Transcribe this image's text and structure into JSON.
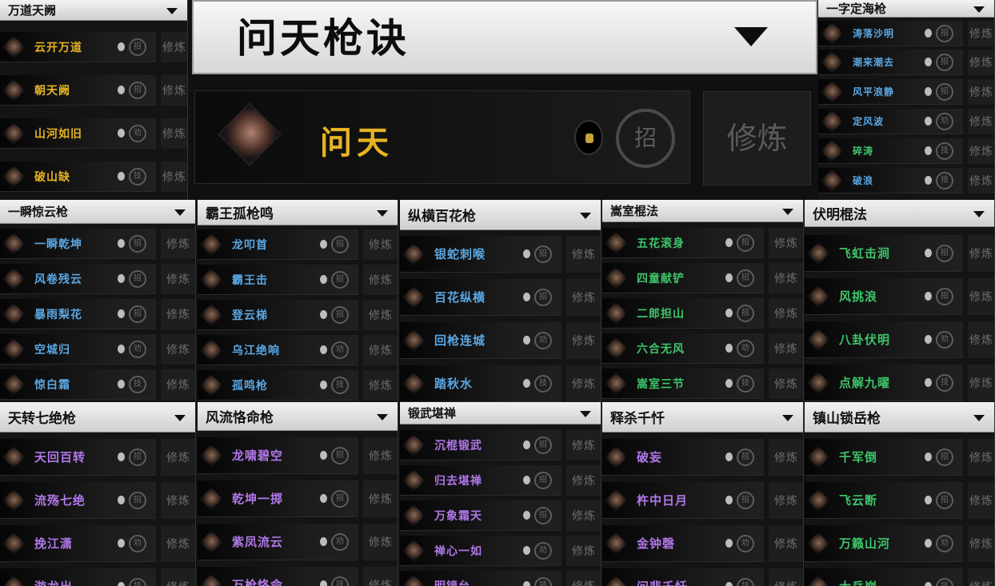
{
  "hero": {
    "title": "问天枪诀",
    "skill": "问天",
    "badge": "招",
    "train": "修炼"
  },
  "common": {
    "train": "修炼"
  },
  "colors": {
    "gold": "#e6b422",
    "blue": "#5aa7e3",
    "green": "#3ec46a",
    "purple": "#b077e8"
  },
  "panels": [
    {
      "title": "万道天阙",
      "color": "gold",
      "items": [
        {
          "name": "云开万道",
          "badge": "招"
        },
        {
          "name": "朝天阙",
          "badge": "招"
        },
        {
          "name": "山河如旧",
          "badge": "劝"
        },
        {
          "name": "破山缺",
          "badge": "技"
        }
      ]
    },
    {
      "title": "一字定海枪",
      "color": "blue",
      "items": [
        {
          "name": "涛落沙明",
          "badge": "招"
        },
        {
          "name": "潮来潮去",
          "badge": "招"
        },
        {
          "name": "风平浪静",
          "badge": "招"
        },
        {
          "name": "定风波",
          "badge": "劝"
        },
        {
          "name": "碎涛",
          "badge": "技",
          "color": "green"
        },
        {
          "name": "破浪",
          "badge": "技"
        }
      ]
    },
    {
      "title": "一瞬惊云枪",
      "color": "blue",
      "items": [
        {
          "name": "一瞬乾坤",
          "badge": "招"
        },
        {
          "name": "风卷残云",
          "badge": "招"
        },
        {
          "name": "暴雨梨花",
          "badge": "招"
        },
        {
          "name": "空城归",
          "badge": "劝"
        },
        {
          "name": "惊白霜",
          "badge": "技"
        }
      ]
    },
    {
      "title": "霸王孤枪鸣",
      "color": "blue",
      "items": [
        {
          "name": "龙叩首",
          "badge": "招"
        },
        {
          "name": "霸王击",
          "badge": "招"
        },
        {
          "name": "登云梯",
          "badge": "招"
        },
        {
          "name": "乌江绝响",
          "badge": "劝"
        },
        {
          "name": "孤鸣枪",
          "badge": "技"
        }
      ]
    },
    {
      "title": "纵横百花枪",
      "color": "blue",
      "items": [
        {
          "name": "银蛇刺喉",
          "badge": "招"
        },
        {
          "name": "百花纵横",
          "badge": "招"
        },
        {
          "name": "回枪连城",
          "badge": "劝"
        },
        {
          "name": "踏秋水",
          "badge": "技"
        }
      ]
    },
    {
      "title": "嵩室棍法",
      "color": "green",
      "items": [
        {
          "name": "五花滚身",
          "badge": "招"
        },
        {
          "name": "四童献铲",
          "badge": "招"
        },
        {
          "name": "二郎担山",
          "badge": "招"
        },
        {
          "name": "六合无风",
          "badge": "劝"
        },
        {
          "name": "嵩室三节",
          "badge": "技"
        }
      ]
    },
    {
      "title": "伏明棍法",
      "color": "green",
      "items": [
        {
          "name": "飞虹击涧",
          "badge": "招"
        },
        {
          "name": "风挑浪",
          "badge": "招"
        },
        {
          "name": "八卦伏明",
          "badge": "劝"
        },
        {
          "name": "点解九曜",
          "badge": "技"
        }
      ]
    },
    {
      "title": "天转七绝枪",
      "color": "purple",
      "items": [
        {
          "name": "天回百转",
          "badge": "招"
        },
        {
          "name": "流殇七绝",
          "badge": "招"
        },
        {
          "name": "挽江潇",
          "badge": "劝"
        },
        {
          "name": "游龙出",
          "badge": "技"
        }
      ]
    },
    {
      "title": "风流恪命枪",
      "color": "purple",
      "items": [
        {
          "name": "龙啸碧空",
          "badge": "招"
        },
        {
          "name": "乾坤一掷",
          "badge": "招"
        },
        {
          "name": "紫凤流云",
          "badge": "劝"
        },
        {
          "name": "万枪恪命",
          "badge": "技"
        }
      ]
    },
    {
      "title": "锻武堪禅",
      "color": "purple",
      "items": [
        {
          "name": "沉棍锻武",
          "badge": "招"
        },
        {
          "name": "归去堪禅",
          "badge": "招"
        },
        {
          "name": "万象霜天",
          "badge": "招"
        },
        {
          "name": "禅心一如",
          "badge": "劝"
        },
        {
          "name": "明镜台",
          "badge": "技"
        }
      ]
    },
    {
      "title": "释杀千忏",
      "color": "purple",
      "items": [
        {
          "name": "破妄",
          "badge": "招"
        },
        {
          "name": "杵中日月",
          "badge": "招"
        },
        {
          "name": "金钟磬",
          "badge": "劝"
        },
        {
          "name": "问悲千忏",
          "badge": "技"
        }
      ]
    },
    {
      "title": "镇山锁岳枪",
      "color": "green",
      "items": [
        {
          "name": "千军倒",
          "badge": "招"
        },
        {
          "name": "飞云断",
          "badge": "招"
        },
        {
          "name": "万籁山河",
          "badge": "劝"
        },
        {
          "name": "大岳崩",
          "badge": "技"
        }
      ]
    }
  ]
}
